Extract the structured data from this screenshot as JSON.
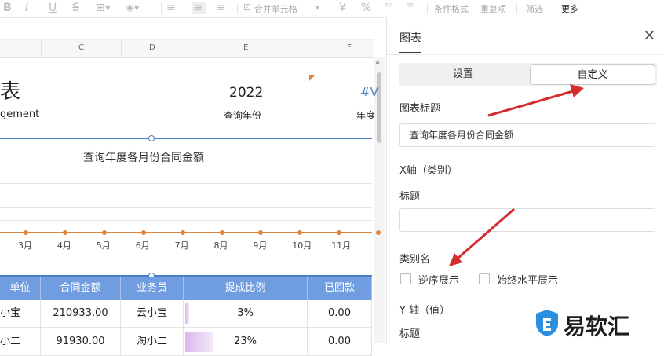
{
  "toolbar": {
    "merge_label": "合并单元格",
    "cond_format": "条件格式",
    "redo": "重复项",
    "filter": "筛选",
    "more": "更多"
  },
  "columns": [
    "C",
    "D",
    "E",
    "F"
  ],
  "sheet": {
    "title_fragment": "表",
    "subtitle_fragment": "gement",
    "year": "2022",
    "year_label": "查询年份",
    "hash_fragment": "#V",
    "year_label2": "年度"
  },
  "chart_data": {
    "type": "line",
    "title": "查询年度各月份合同金额",
    "categories": [
      "3月",
      "4月",
      "5月",
      "6月",
      "7月",
      "8月",
      "9月",
      "10月",
      "11月"
    ],
    "series": [
      {
        "values": [
          0,
          0,
          0,
          0,
          0,
          0,
          0,
          0,
          0,
          0,
          0
        ]
      }
    ],
    "colors": {
      "line": "#e0843a"
    }
  },
  "table": {
    "headers": [
      "单位",
      "合同金额",
      "业务员",
      "提成比例",
      "已回款"
    ],
    "rows": [
      [
        "小宝",
        "210933.00",
        "云小宝",
        "3%",
        "0.00"
      ],
      [
        "小二",
        "91930.00",
        "淘小二",
        "23%",
        "0.00"
      ]
    ],
    "colors": {
      "header": "#6f9de0"
    }
  },
  "panel": {
    "title": "图表",
    "tabs": [
      "设置",
      "自定义"
    ],
    "active_tab": "自定义",
    "chart_title_label": "图表标题",
    "chart_title_value": "查询年度各月份合同金额",
    "x_axis_label": "X轴（类别）",
    "x_title_label": "标题",
    "x_title_value": "",
    "category_name_label": "类别名",
    "reverse_label": "逆序展示",
    "horizontal_label": "始终水平展示",
    "y_axis_label": "Y 轴（值）",
    "y_title_label": "标题"
  },
  "watermark": {
    "text": "易软汇"
  }
}
